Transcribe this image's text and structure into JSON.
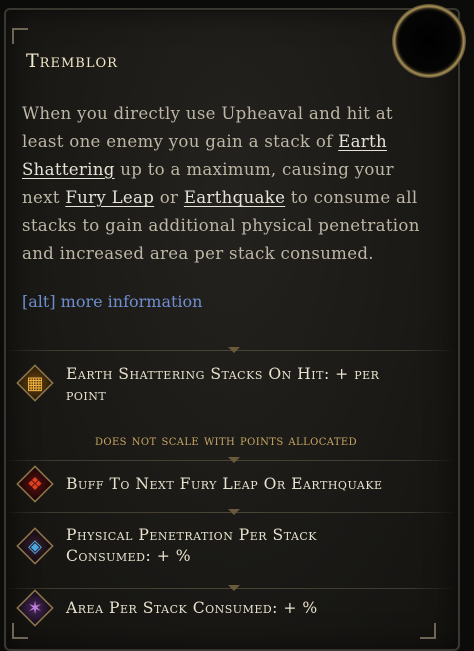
{
  "tooltip": {
    "title": "Tremblor",
    "description": {
      "p1": "When you directly use Upheaval and hit at least one enemy you gain a stack of ",
      "kw1": "Earth Shattering",
      "p2": " up to a maximum, causing your next ",
      "kw2": "Fury Leap",
      "p3": " or ",
      "kw3": "Earthquake",
      "p4": " to consume all stacks to gain additional physical penetration and increased area per stack consumed."
    },
    "more_info": "[alt] more information"
  },
  "stats": [
    {
      "icon": "earth-shattering-icon",
      "label_line1": "Earth Shattering Stacks On Hit: +    per",
      "label_line2": "point"
    },
    {
      "icon": "fury-leap-buff-icon",
      "label_line1": "Buff To Next Fury Leap Or Earthquake"
    },
    {
      "icon": "physical-penetration-icon",
      "label_line1": "Physical Penetration Per Stack",
      "label_line2": "Consumed: +     %"
    },
    {
      "icon": "area-icon",
      "label_line1": "Area Per Stack Consumed: +     %"
    }
  ],
  "note": "does not scale with points allocated",
  "colors": {
    "title": "#f0e6c8",
    "body": "#bdb6a5",
    "link": "#6f8ed0",
    "note": "#c9a765",
    "frame": "#8b7448"
  }
}
